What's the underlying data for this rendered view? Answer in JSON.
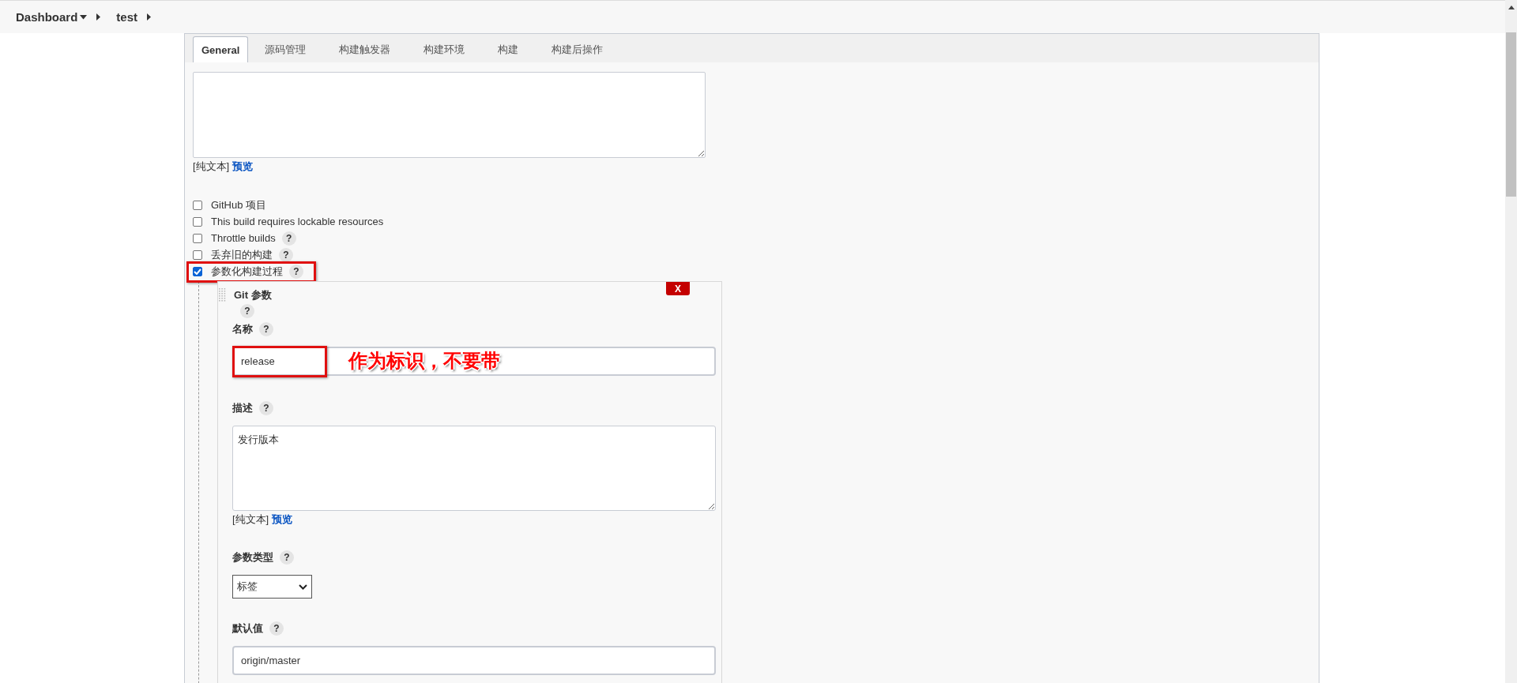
{
  "breadcrumbs": [
    {
      "label": "Dashboard",
      "menu": true
    },
    {
      "label": "test",
      "menu": false
    }
  ],
  "tabs": [
    {
      "label": "General",
      "selected": true
    },
    {
      "label": "源码管理",
      "selected": false
    },
    {
      "label": "构建触发器",
      "selected": false
    },
    {
      "label": "构建环境",
      "selected": false
    },
    {
      "label": "构建",
      "selected": false
    },
    {
      "label": "构建后操作",
      "selected": false
    }
  ],
  "description_editor": {
    "format_label": "[纯文本]",
    "preview_link": "预览"
  },
  "options": [
    {
      "label": "GitHub 项目",
      "checked": false,
      "highlighted": false
    },
    {
      "label": "This build requires lockable resources",
      "checked": false,
      "highlighted": false
    },
    {
      "label": "Throttle builds",
      "checked": false,
      "help": "?",
      "highlighted": false
    },
    {
      "label": "丢弃旧的构建",
      "checked": false,
      "help": "?",
      "highlighted": false
    },
    {
      "label": "参数化构建过程",
      "checked": true,
      "help": "?",
      "highlighted": true
    }
  ],
  "parameter": {
    "title": "Git 参数",
    "help": "?",
    "remove": "X",
    "fields": [
      {
        "kind": "text",
        "label": "名称",
        "help": "?",
        "value": "release",
        "highlighted": true,
        "annotation": "作为标识，不要带"
      },
      {
        "kind": "textarea",
        "label": "描述",
        "help": "?",
        "value": "发行版本",
        "format_label": "[纯文本]",
        "preview_link": "预览",
        "highlighted": false
      },
      {
        "kind": "select",
        "label": "参数类型",
        "help": "?",
        "value": "标签",
        "highlighted": false
      },
      {
        "kind": "text",
        "label": "默认值",
        "help": "?",
        "value": "origin/master",
        "highlighted": false
      }
    ]
  }
}
